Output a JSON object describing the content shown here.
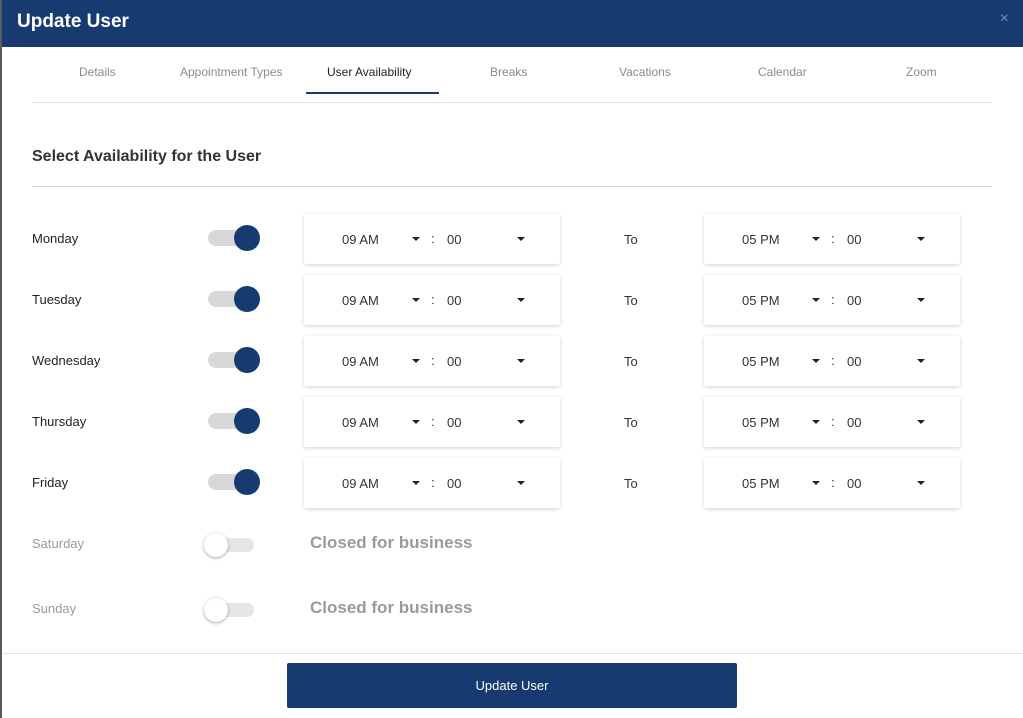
{
  "modal": {
    "title": "Update User",
    "close_icon": "close-icon",
    "close_glyph": "×"
  },
  "tabs": [
    {
      "label": "Details",
      "active": false
    },
    {
      "label": "Appointment Types",
      "active": false
    },
    {
      "label": "User Availability",
      "active": true
    },
    {
      "label": "Breaks",
      "active": false
    },
    {
      "label": "Vacations",
      "active": false
    },
    {
      "label": "Calendar",
      "active": false
    },
    {
      "label": "Zoom",
      "active": false
    }
  ],
  "section": {
    "title": "Select Availability for the User"
  },
  "to_label": "To",
  "colon": ":",
  "days": [
    {
      "name": "Monday",
      "enabled": true,
      "start_hour": "09 AM",
      "start_minute": "00",
      "end_hour": "05 PM",
      "end_minute": "00"
    },
    {
      "name": "Tuesday",
      "enabled": true,
      "start_hour": "09 AM",
      "start_minute": "00",
      "end_hour": "05 PM",
      "end_minute": "00"
    },
    {
      "name": "Wednesday",
      "enabled": true,
      "start_hour": "09 AM",
      "start_minute": "00",
      "end_hour": "05 PM",
      "end_minute": "00"
    },
    {
      "name": "Thursday",
      "enabled": true,
      "start_hour": "09 AM",
      "start_minute": "00",
      "end_hour": "05 PM",
      "end_minute": "00"
    },
    {
      "name": "Friday",
      "enabled": true,
      "start_hour": "09 AM",
      "start_minute": "00",
      "end_hour": "05 PM",
      "end_minute": "00"
    },
    {
      "name": "Saturday",
      "enabled": false,
      "closed_text": "Closed for business"
    },
    {
      "name": "Sunday",
      "enabled": false,
      "closed_text": "Closed for business"
    }
  ],
  "footer": {
    "button_label": "Update User"
  },
  "colors": {
    "primary": "#173a70",
    "header_bg": "#173a70",
    "toggle_track": "#d8d8d8",
    "muted_text": "#9a9a9a"
  }
}
